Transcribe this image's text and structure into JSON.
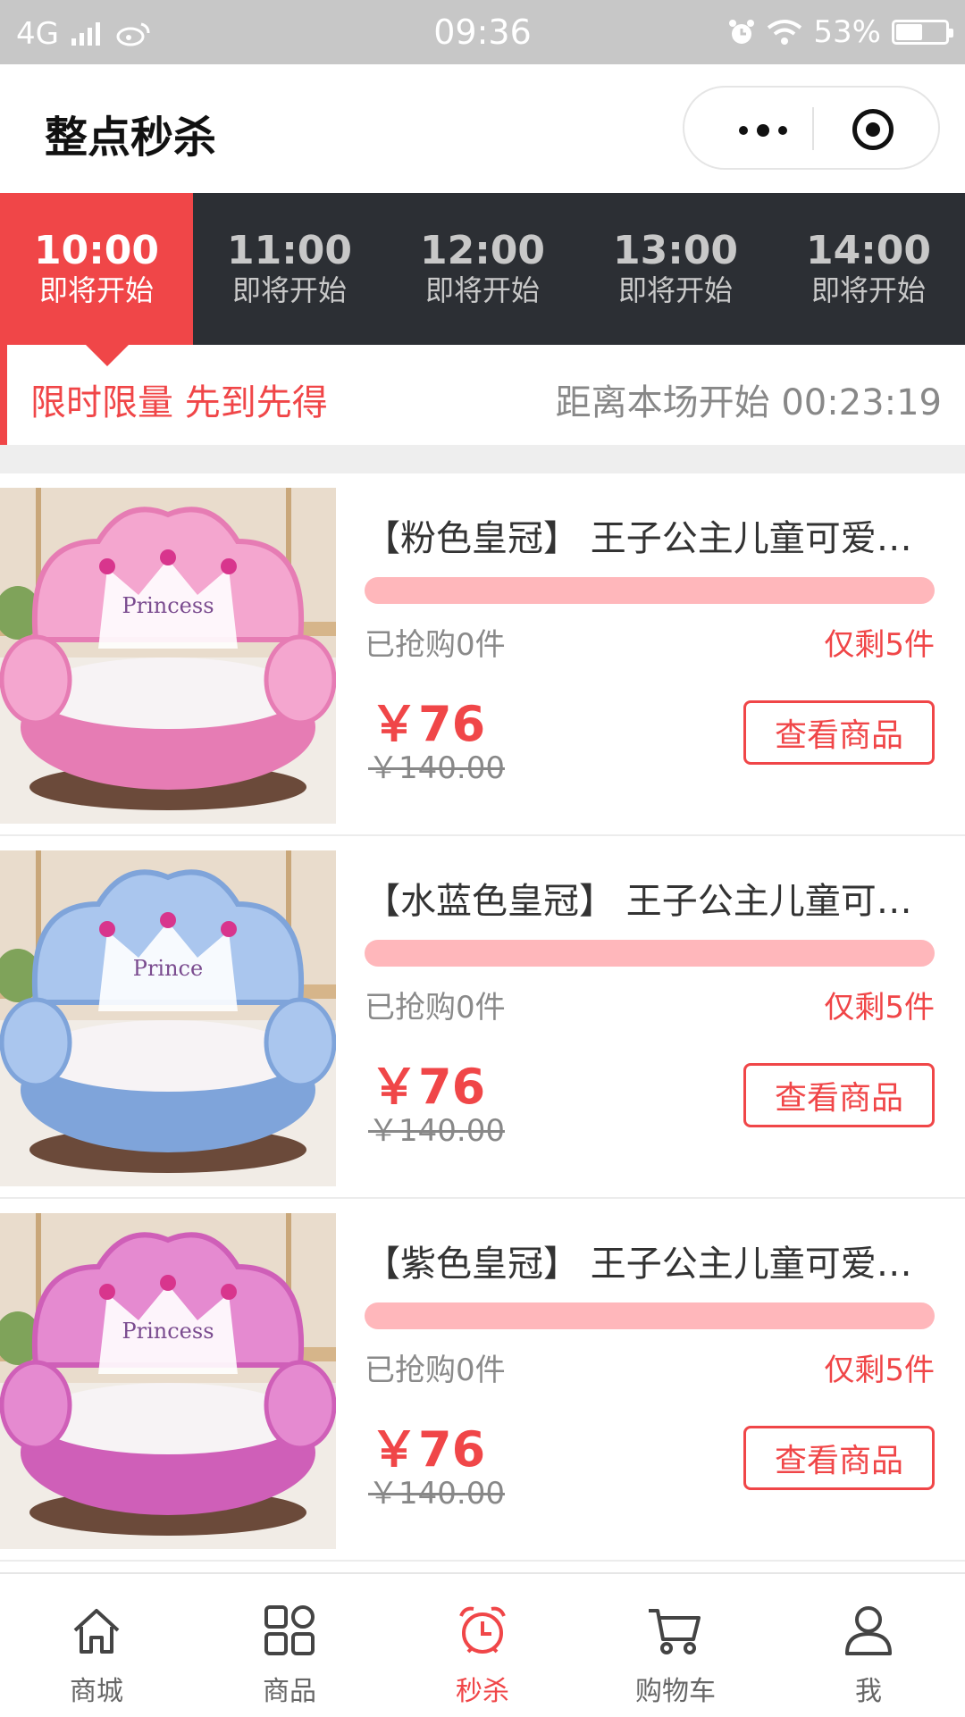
{
  "status_bar": {
    "network": "4G",
    "time": "09:36",
    "battery_percent": "53%",
    "battery_level": 53
  },
  "navbar": {
    "title": "整点秒杀"
  },
  "time_tabs": [
    {
      "time": "10:00",
      "status": "即将开始",
      "active": true
    },
    {
      "time": "11:00",
      "status": "即将开始",
      "active": false
    },
    {
      "time": "12:00",
      "status": "即将开始",
      "active": false
    },
    {
      "time": "13:00",
      "status": "即将开始",
      "active": false
    },
    {
      "time": "14:00",
      "status": "即将开始",
      "active": false
    }
  ],
  "notice": {
    "slogan": "限时限量 先到先得",
    "countdown_label": "距离本场开始",
    "countdown": "00:23:19"
  },
  "products": [
    {
      "title": "【粉色皇冠】 王子公主儿童可爱卡通懒人沙发",
      "sold": "已抢购0件",
      "remaining": "仅剩5件",
      "progress": 0,
      "price": "￥76",
      "original_price": "￥140.00",
      "button": "查看商品",
      "image_label": "Princess",
      "color": "#f4a6cf",
      "color_dark": "#e67cb4"
    },
    {
      "title": "【水蓝色皇冠】 王子公主儿童可爱卡通懒人沙发",
      "sold": "已抢购0件",
      "remaining": "仅剩5件",
      "progress": 0,
      "price": "￥76",
      "original_price": "￥140.00",
      "button": "查看商品",
      "image_label": "Prince",
      "color": "#aac6ee",
      "color_dark": "#7fa4da"
    },
    {
      "title": "【紫色皇冠】 王子公主儿童可爱卡通懒人沙发",
      "sold": "已抢购0件",
      "remaining": "仅剩5件",
      "progress": 0,
      "price": "￥76",
      "original_price": "￥140.00",
      "button": "查看商品",
      "image_label": "Princess",
      "color": "#e58ad0",
      "color_dark": "#cf5fb8"
    }
  ],
  "bottom_nav": [
    {
      "label": "商城",
      "icon": "home-icon",
      "active": false
    },
    {
      "label": "商品",
      "icon": "grid-icon",
      "active": false
    },
    {
      "label": "秒杀",
      "icon": "alarm-clock-icon",
      "active": true
    },
    {
      "label": "购物车",
      "icon": "cart-icon",
      "active": false
    },
    {
      "label": "我",
      "icon": "user-icon",
      "active": false
    }
  ],
  "colors": {
    "accent": "#f04648",
    "tab_bar": "#2c2f34",
    "progress_track": "#ffb7bb"
  }
}
